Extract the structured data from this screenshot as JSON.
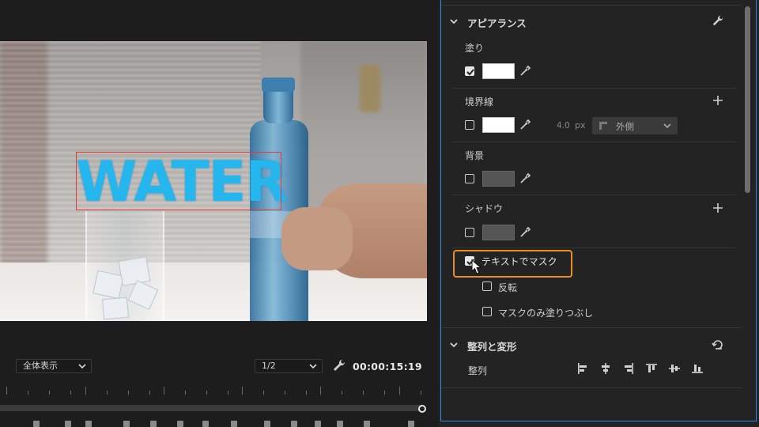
{
  "monitor": {
    "overlay_text": "WATER",
    "fit_label": "全体表示",
    "resolution_label": "1/2",
    "timecode": "00:00:15:19"
  },
  "panel": {
    "appearance": {
      "title": "アピアランス",
      "fill_label": "塗り",
      "fill_checked": true,
      "fill_color": "#ffffff",
      "stroke_label": "境界線",
      "stroke_checked": false,
      "stroke_color": "#ffffff",
      "stroke_width": "4.0",
      "stroke_unit": "px",
      "stroke_position": "外側",
      "background_label": "背景",
      "background_checked": false,
      "shadow_label": "シャドウ",
      "shadow_checked": false,
      "mask_label": "テキストでマスク",
      "mask_checked": true,
      "invert_label": "反転",
      "invert_checked": false,
      "mask_fill_only_label": "マスクのみ塗りつぶし",
      "mask_fill_only_checked": false
    },
    "align": {
      "title": "整列と変形",
      "align_label": "整列",
      "buttons": [
        "align-left-icon",
        "align-center-h-icon",
        "align-right-icon",
        "align-top-icon",
        "align-center-v-icon",
        "align-bottom-icon"
      ]
    }
  },
  "colors": {
    "accent_highlight": "#f08c1e",
    "panel_border": "#2d8ceb",
    "selection_box": "#e53a3a"
  }
}
